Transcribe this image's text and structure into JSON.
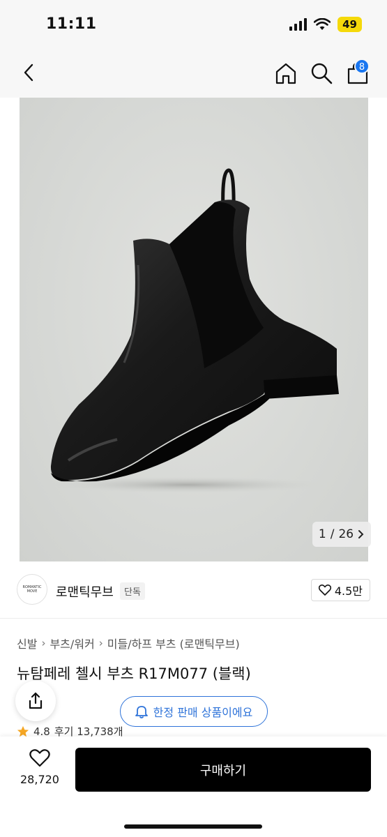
{
  "status": {
    "time": "11:11",
    "battery": "49"
  },
  "nav": {
    "cart_count": "8"
  },
  "gallery": {
    "current": "1",
    "total": "26",
    "separator": "/"
  },
  "brand": {
    "logo_text": "ROMANTIC MOVE",
    "name": "로맨틱무브",
    "tag": "단독",
    "likes": "4.5만"
  },
  "breadcrumb": [
    "신발",
    "부츠/워커",
    "미들/하프 부츠 (로맨틱무브)"
  ],
  "product": {
    "title": "뉴탐페레 첼시 부츠 R17M077 (블랙)"
  },
  "notice": {
    "label": "한정 판매 상품이에요"
  },
  "rating": {
    "score": "4.8",
    "reviews": "후기 13,738개"
  },
  "bottom": {
    "wish_count": "28,720",
    "buy_label": "구매하기"
  },
  "colors": {
    "accent": "#2e73d9",
    "badge": "#1976f0",
    "buy": "#000000",
    "star": "#f5a623"
  },
  "icons": [
    "back-icon",
    "home-icon",
    "search-icon",
    "cart-icon",
    "heart-icon",
    "share-icon",
    "bell-icon",
    "star-icon",
    "chevron-right-icon"
  ]
}
